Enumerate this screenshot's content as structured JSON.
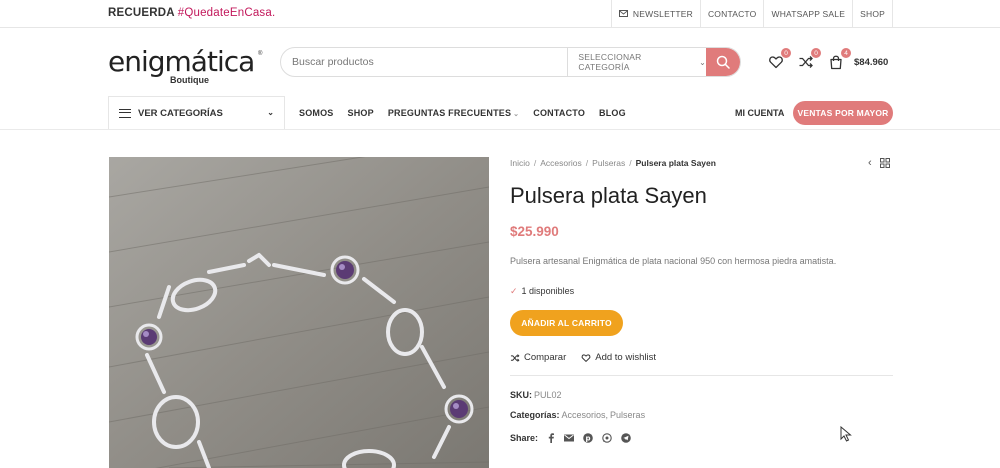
{
  "topbar": {
    "promo_prefix": "RECUERDA ",
    "promo_hashtag": "#QuedateEnCasa.",
    "links": [
      {
        "label": "NEWSLETTER",
        "icon": "envelope-icon"
      },
      {
        "label": "CONTACTO"
      },
      {
        "label": "WHATSAPP SALE"
      },
      {
        "label": "SHOP"
      }
    ]
  },
  "header": {
    "logo_text": "enigmática",
    "logo_sub": "Boutique",
    "logo_reg": "®",
    "search_placeholder": "Buscar productos",
    "category_select": "SELECCIONAR CATEGORÍA",
    "wishlist_count": "0",
    "compare_count": "0",
    "cart_count": "4",
    "cart_total": "$84.960"
  },
  "nav": {
    "categories_label": "VER CATEGORÍAS",
    "menu": [
      {
        "label": "SOMOS"
      },
      {
        "label": "SHOP"
      },
      {
        "label": "PREGUNTAS FRECUENTES",
        "dropdown": true
      },
      {
        "label": "CONTACTO"
      },
      {
        "label": "BLOG"
      }
    ],
    "account_label": "MI CUENTA",
    "wholesale_label": "VENTAS POR MAYOR"
  },
  "breadcrumb": {
    "items": [
      "Inicio",
      "Accesorios",
      "Pulseras"
    ],
    "current": "Pulsera plata Sayen"
  },
  "product": {
    "title": "Pulsera plata Sayen",
    "price": "$25.990",
    "description": "Pulsera artesanal Enigmática de plata nacional 950 con hermosa piedra amatista.",
    "stock": "1 disponibles",
    "add_to_cart": "AÑADIR AL CARRITO",
    "compare_label": "Comparar",
    "wishlist_label": "Add to wishlist",
    "sku_label": "SKU:",
    "sku_value": "PUL02",
    "categories_label": "Categorías:",
    "categories": [
      "Accesorios",
      "Pulseras"
    ],
    "share_label": "Share:",
    "share_icons": [
      "facebook-icon",
      "email-icon",
      "pinterest-icon",
      "whatsapp-icon",
      "telegram-icon"
    ]
  },
  "colors": {
    "accent": "#e07b7b",
    "cart_button": "#f0a21e",
    "promo_hashtag": "#c2185b"
  }
}
